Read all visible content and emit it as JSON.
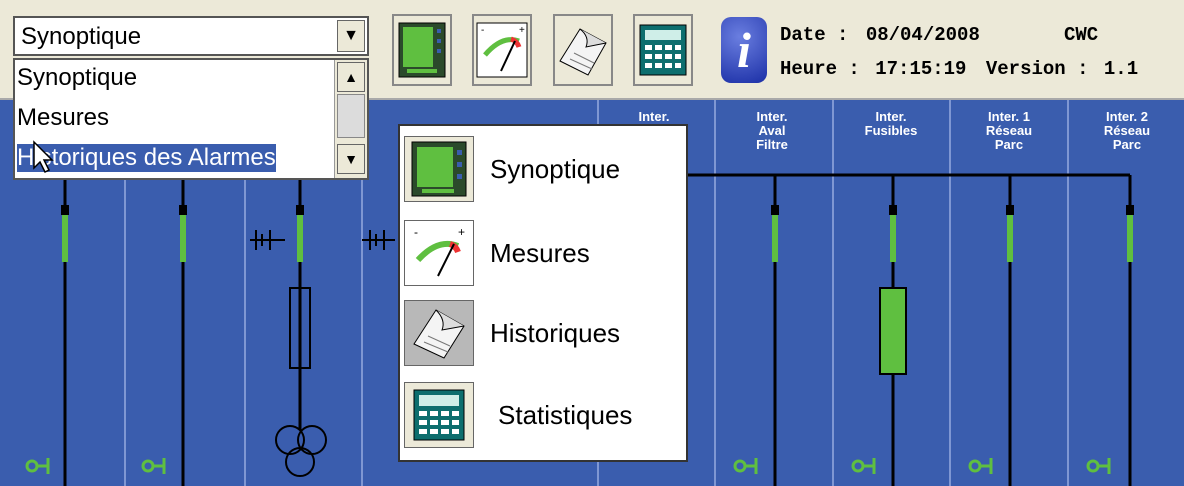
{
  "toolbar": {
    "combo_value": "Synoptique",
    "buttons": [
      "synoptique-icon",
      "mesures-icon",
      "historiques-icon",
      "statistiques-icon",
      "info-icon"
    ]
  },
  "status": {
    "date_label": "Date :",
    "date_value": "08/04/2008",
    "time_label": "Heure :",
    "time_value": "17:15:19",
    "app": "CWC",
    "version_label": "Version :",
    "version_value": "1.1"
  },
  "dropdown_list": {
    "items": [
      "Synoptique",
      "Mesures",
      "Historiques des Alarmes"
    ],
    "selected_index": 2
  },
  "columns": [
    {
      "label": "Inter."
    },
    {
      "label": "Inter.\nAval\nFiltre"
    },
    {
      "label": "Inter.\nFusibles"
    },
    {
      "label": "Inter. 1\nRéseau\nParc"
    },
    {
      "label": "Inter. 2\nRéseau\nParc"
    }
  ],
  "popup_menu": {
    "items": [
      {
        "label": "Synoptique",
        "icon": "synoptique-icon"
      },
      {
        "label": "Mesures",
        "icon": "mesures-icon"
      },
      {
        "label": "Historiques",
        "icon": "historiques-icon"
      },
      {
        "label": "Statistiques",
        "icon": "statistiques-icon"
      }
    ]
  },
  "colors": {
    "background": "#3a5dae",
    "switch_green": "#5fbf40",
    "toolbar": "#ece9d8"
  }
}
